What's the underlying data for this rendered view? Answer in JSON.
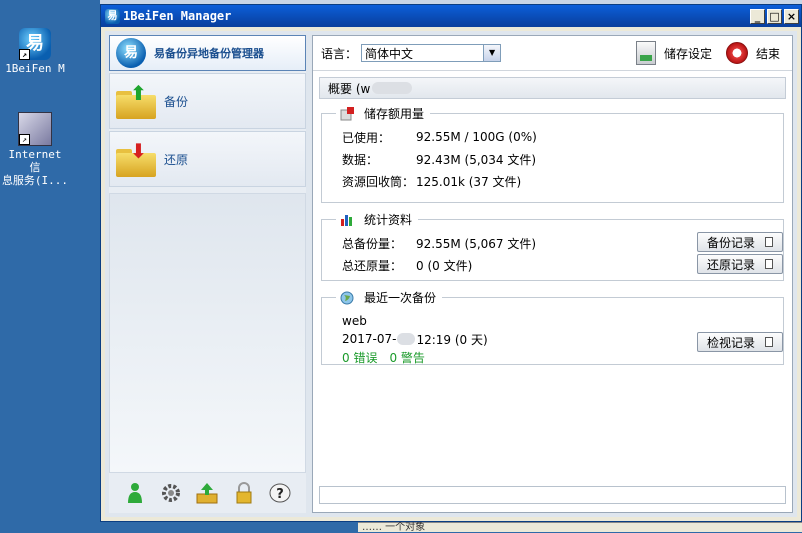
{
  "desktop": {
    "icons": [
      {
        "label": "1BeiFen M",
        "glyph": "易"
      },
      {
        "label": "Internet 信\n息服务(I...",
        "glyph": ""
      }
    ],
    "bottom_strip_text": "…… 一个对象"
  },
  "window": {
    "title": "1BeiFen Manager",
    "icon_glyph": "易",
    "controls": {
      "minimize": "_",
      "maximize": "□",
      "close": "×"
    }
  },
  "sidebar": {
    "header_name": "易备份异地备份管理器",
    "logo_glyph": "易",
    "items": [
      {
        "label": "备份",
        "arrow": "⬆",
        "arrow_color": "#1fa52e"
      },
      {
        "label": "还原",
        "arrow": "⬇",
        "arrow_color": "#d62020"
      }
    ],
    "footer_icons": [
      "user-icon",
      "gear-icon",
      "upload-icon",
      "lock-icon",
      "help-icon"
    ]
  },
  "toolbar": {
    "language_label": "语言：",
    "language_value": "简体中文",
    "save_settings_label": "储存设定",
    "exit_label": "结束"
  },
  "overview": {
    "title": "概要 (w"
  },
  "storage": {
    "title": "储存额用量",
    "rows": [
      {
        "key": "已使用：",
        "value": "92.55M / 100G (0%)"
      },
      {
        "key": "数据：",
        "value": "92.43M  (5,034 文件)"
      },
      {
        "key": "资源回收筒：",
        "value": "125.01k  (37 文件)"
      }
    ]
  },
  "stats": {
    "title": "统计资料",
    "total_backup_key": "总备份量：",
    "total_backup_value": "92.55M  (5,067 文件)",
    "total_restore_key": "总还原量：",
    "total_restore_value": "0  (0 文件)",
    "backup_log_button": "备份记录",
    "restore_log_button": "还原记录"
  },
  "last_backup": {
    "title": "最近一次备份",
    "name": "web",
    "date_prefix": "2017-07-",
    "date_suffix": "12:19 (0 天)",
    "errors": "0 错误",
    "warnings": "0 警告",
    "view_log_button": "检视记录"
  },
  "colors": {
    "accent": "#1b4f8f",
    "titlebar": "#0a4bb4",
    "ok_text": "#1a9a2a"
  }
}
